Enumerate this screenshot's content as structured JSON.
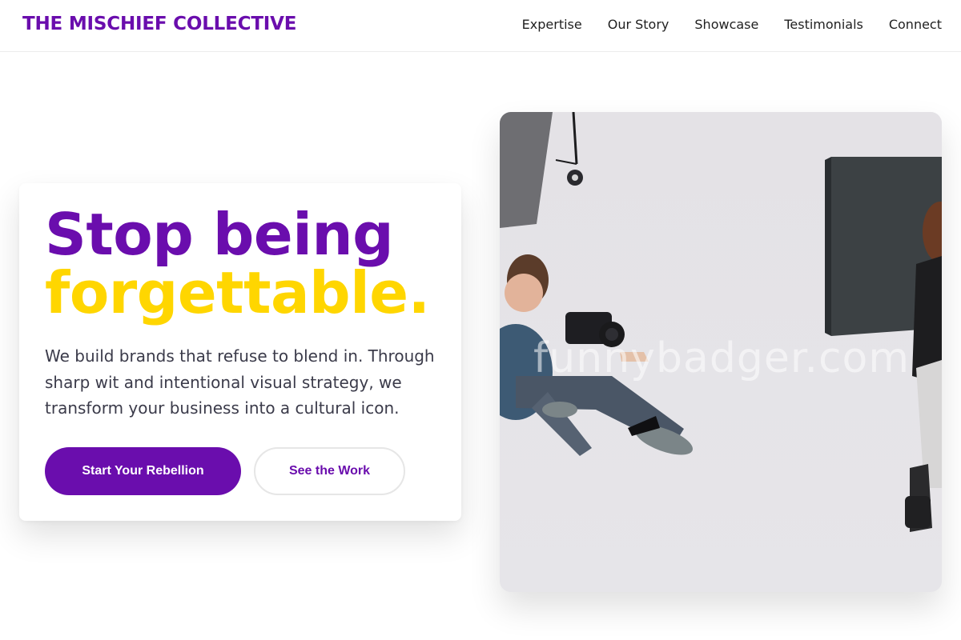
{
  "header": {
    "brand": "THE MISCHIEF COLLECTIVE",
    "nav": [
      {
        "label": "Expertise"
      },
      {
        "label": "Our Story"
      },
      {
        "label": "Showcase"
      },
      {
        "label": "Testimonials"
      },
      {
        "label": "Connect"
      }
    ]
  },
  "hero": {
    "headline_line1": "Stop being",
    "headline_line2": "forgettable.",
    "description": "We build brands that refuse to blend in. Through sharp wit and intentional visual strategy, we transform your business into a cultural icon.",
    "primary_cta": "Start Your Rebellion",
    "secondary_cta": "See the Work"
  },
  "image": {
    "watermark": "funnybadger.com"
  },
  "colors": {
    "brand_purple": "#6a0dad",
    "accent_yellow": "#ffd600",
    "body_text": "#3b3b4a"
  }
}
